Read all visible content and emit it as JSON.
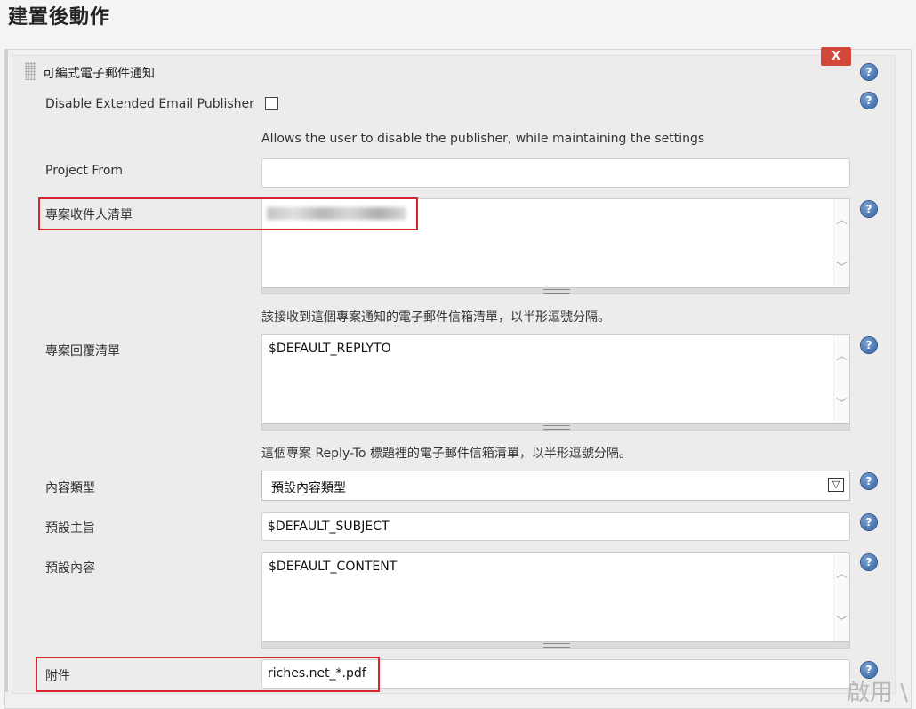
{
  "page": {
    "title": "建置後動作"
  },
  "section": {
    "title": "可編式電子郵件通知",
    "delete_label": "X",
    "help_glyph": "?"
  },
  "fields": {
    "disable_publisher": {
      "label": "Disable Extended Email Publisher",
      "checked": false,
      "description": "Allows the user to disable the publisher, while maintaining the settings"
    },
    "project_from": {
      "label": "Project From",
      "value": ""
    },
    "recipient_list": {
      "label": "專案收件人清單",
      "value": "(blurred email address)",
      "description": "該接收到這個專案通知的電子郵件信箱清單，以半形逗號分隔。"
    },
    "reply_to_list": {
      "label": "專案回覆清單",
      "value": "$DEFAULT_REPLYTO",
      "description": "這個專案 Reply-To 標題裡的電子郵件信箱清單，以半形逗號分隔。"
    },
    "content_type": {
      "label": "內容類型",
      "selected": "預設內容類型"
    },
    "default_subject": {
      "label": "預設主旨",
      "value": "$DEFAULT_SUBJECT"
    },
    "default_content": {
      "label": "預設內容",
      "value": "$DEFAULT_CONTENT"
    },
    "attachments": {
      "label": "附件",
      "value": "riches.net_*.pdf"
    }
  },
  "scroll_glyphs": {
    "up": "︿",
    "down": "﹀",
    "dropdown": "▽"
  },
  "corner_text": "啟用 \\",
  "colors": {
    "delete_button": "#d24939",
    "highlight_box": "#d6252e",
    "help_icon": "#2f5c9c"
  }
}
